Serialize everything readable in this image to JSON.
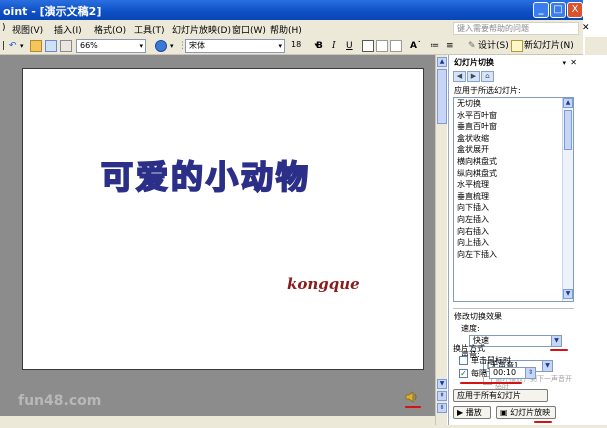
{
  "window": {
    "title": "oint - [演示文稿2]",
    "minimize": "_",
    "maximize": "□",
    "close": "X"
  },
  "menubar": {
    "items": [
      "视图(V)",
      "插入(I)",
      "格式(O)",
      "工具(T)",
      "幻灯片放映(D)",
      "窗口(W)",
      "帮助(H)"
    ],
    "help_placeholder": "键入需要帮助的问题"
  },
  "toolbar": {
    "zoom": "66%",
    "font": "宋体",
    "font_size": "18",
    "bold": "B",
    "italic": "I",
    "underline": "U",
    "design": "设计(S)",
    "new_slide": "新幻灯片(N)"
  },
  "slide": {
    "title": "可爱的小动物",
    "subtitle": "kongque"
  },
  "watermark": "fun48.com",
  "task_pane": {
    "title": "幻灯片切换",
    "apply_label": "应用于所选幻灯片:",
    "transitions": [
      "无切换",
      "水平百叶窗",
      "垂直百叶窗",
      "盒状收缩",
      "盒状展开",
      "横向棋盘式",
      "纵向棋盘式",
      "水平梳理",
      "垂直梳理",
      "向下插入",
      "向左插入",
      "向右插入",
      "向上插入",
      "向左下插入"
    ],
    "modify_section": "修改切换效果",
    "speed_label": "速度:",
    "speed_value": "快速",
    "sound_label": "声音:",
    "sound_value": "[无声音]",
    "loop_label": "循环播放，到下一声音开始时",
    "advance_section": "换片方式",
    "on_click_label": "单击鼠标时",
    "on_click_checked": false,
    "every_label": "每隔",
    "every_checked": true,
    "every_value": "00:10",
    "apply_all_button": "应用于所有幻灯片",
    "play_button": "播放",
    "slideshow_button": "幻灯片放映"
  },
  "colors": {
    "title_bar": "#0d4fc4",
    "workspace": "#8c8c8c",
    "slide_title_stroke": "#2b2f88",
    "slide_subtitle": "#8a1c1c",
    "annotation_red": "#d21414"
  }
}
